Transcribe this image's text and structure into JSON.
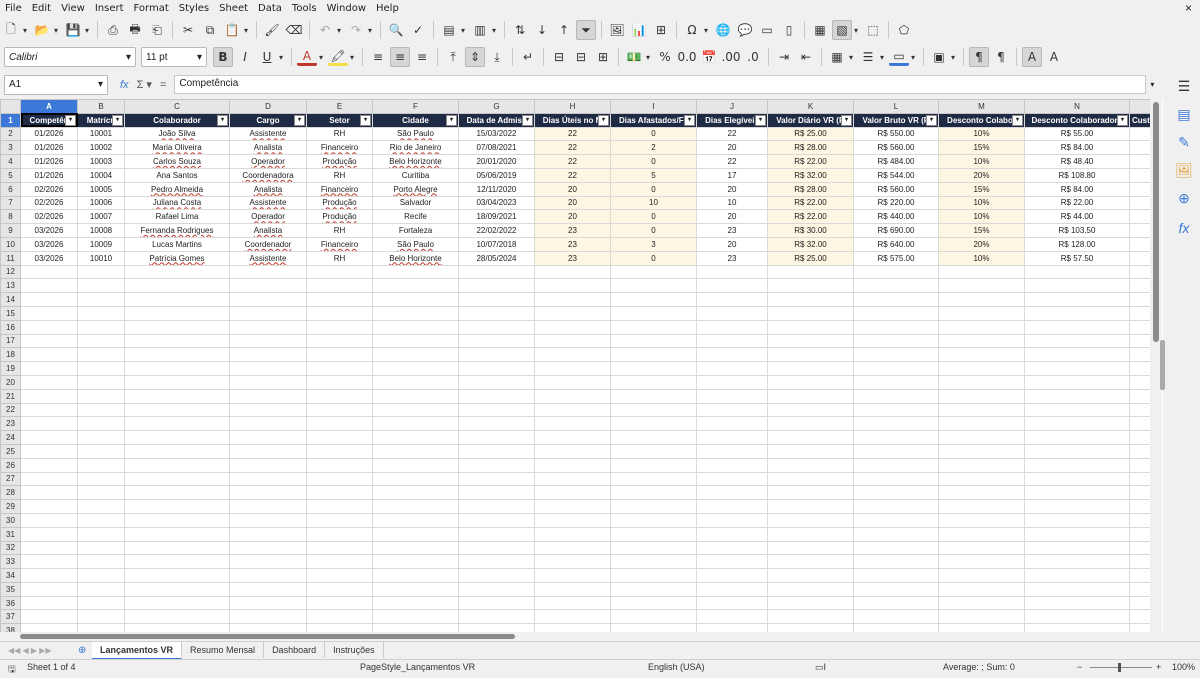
{
  "menu": [
    "File",
    "Edit",
    "View",
    "Insert",
    "Format",
    "Styles",
    "Sheet",
    "Data",
    "Tools",
    "Window",
    "Help"
  ],
  "window": {
    "close_glyph": "×"
  },
  "toolbar": {
    "font_name": "Calibri",
    "font_size": "11 pt",
    "bold_label": "B",
    "italic_label": "I",
    "underline_label": "U"
  },
  "formula_bar": {
    "cell_ref": "A1",
    "content": "Competência"
  },
  "columns": [
    "A",
    "B",
    "C",
    "D",
    "E",
    "F",
    "G",
    "H",
    "I",
    "J",
    "K",
    "L",
    "M",
    "N",
    ""
  ],
  "headers": [
    "Competên",
    "Matrícu",
    "Colaborador",
    "Cargo",
    "Setor",
    "Cidade",
    "Data de Admiss",
    "Dias Úteis no M",
    "Dias Afastados/Fé",
    "Dias Elegíveis",
    "Valor Diário VR (R",
    "Valor Bruto VR (R",
    "Desconto Colabor",
    "Desconto Colaborador (",
    "Cust"
  ],
  "rows": [
    [
      "01/2026",
      "10001",
      "João Silva",
      "Assistente",
      "RH",
      "São Paulo",
      "15/03/2022",
      "22",
      "0",
      "22",
      "R$ 25.00",
      "R$ 550.00",
      "10%",
      "R$ 55.00",
      ""
    ],
    [
      "01/2026",
      "10002",
      "Maria Oliveira",
      "Analista",
      "Financeiro",
      "Rio de Janeiro",
      "07/08/2021",
      "22",
      "2",
      "20",
      "R$ 28.00",
      "R$ 560.00",
      "15%",
      "R$ 84.00",
      ""
    ],
    [
      "01/2026",
      "10003",
      "Carlos Souza",
      "Operador",
      "Produção",
      "Belo Horizonte",
      "20/01/2020",
      "22",
      "0",
      "22",
      "R$ 22.00",
      "R$ 484.00",
      "10%",
      "R$ 48.40",
      ""
    ],
    [
      "01/2026",
      "10004",
      "Ana Santos",
      "Coordenadora",
      "RH",
      "Curitiba",
      "05/06/2019",
      "22",
      "5",
      "17",
      "R$ 32.00",
      "R$ 544.00",
      "20%",
      "R$ 108.80",
      ""
    ],
    [
      "02/2026",
      "10005",
      "Pedro Almeida",
      "Analista",
      "Financeiro",
      "Porto Alegre",
      "12/11/2020",
      "20",
      "0",
      "20",
      "R$ 28.00",
      "R$ 560.00",
      "15%",
      "R$ 84.00",
      ""
    ],
    [
      "02/2026",
      "10006",
      "Juliana Costa",
      "Assistente",
      "Produção",
      "Salvador",
      "03/04/2023",
      "20",
      "10",
      "10",
      "R$ 22.00",
      "R$ 220.00",
      "10%",
      "R$ 22.00",
      ""
    ],
    [
      "02/2026",
      "10007",
      "Rafael Lima",
      "Operador",
      "Produção",
      "Recife",
      "18/09/2021",
      "20",
      "0",
      "20",
      "R$ 22.00",
      "R$ 440.00",
      "10%",
      "R$ 44.00",
      ""
    ],
    [
      "03/2026",
      "10008",
      "Fernanda Rodrigues",
      "Analista",
      "RH",
      "Fortaleza",
      "22/02/2022",
      "23",
      "0",
      "23",
      "R$ 30.00",
      "R$ 690.00",
      "15%",
      "R$ 103.50",
      ""
    ],
    [
      "03/2026",
      "10009",
      "Lucas Martins",
      "Coordenador",
      "Financeiro",
      "São Paulo",
      "10/07/2018",
      "23",
      "3",
      "20",
      "R$ 32.00",
      "R$ 640.00",
      "20%",
      "R$ 128.00",
      ""
    ],
    [
      "03/2026",
      "10010",
      "Patrícia Gomes",
      "Assistente",
      "RH",
      "Belo Horizonte",
      "28/05/2024",
      "23",
      "0",
      "23",
      "R$ 25.00",
      "R$ 575.00",
      "10%",
      "R$ 57.50",
      ""
    ]
  ],
  "row_numbers": [
    "1",
    "2",
    "3",
    "4",
    "5",
    "6",
    "7",
    "8",
    "9",
    "10",
    "11",
    "12",
    "13",
    "14",
    "15",
    "16",
    "17",
    "18",
    "19",
    "20",
    "21",
    "22",
    "23",
    "24",
    "25",
    "26",
    "27",
    "28",
    "29",
    "30",
    "31",
    "32",
    "33",
    "34",
    "35",
    "36",
    "37",
    "38"
  ],
  "sheet_tabs": [
    "Lançamentos VR",
    "Resumo Mensal",
    "Dashboard",
    "Instruções"
  ],
  "status": {
    "sheet_info": "Sheet 1 of 4",
    "page_style": "PageStyle_Lançamentos VR",
    "language": "English (USA)",
    "aggregate": "Average: ; Sum: 0",
    "zoom": "100%"
  },
  "colors": {
    "header_bg": "#1f2a44",
    "selection": "#3c78d8",
    "highlight_col": "#fdf6e3"
  }
}
